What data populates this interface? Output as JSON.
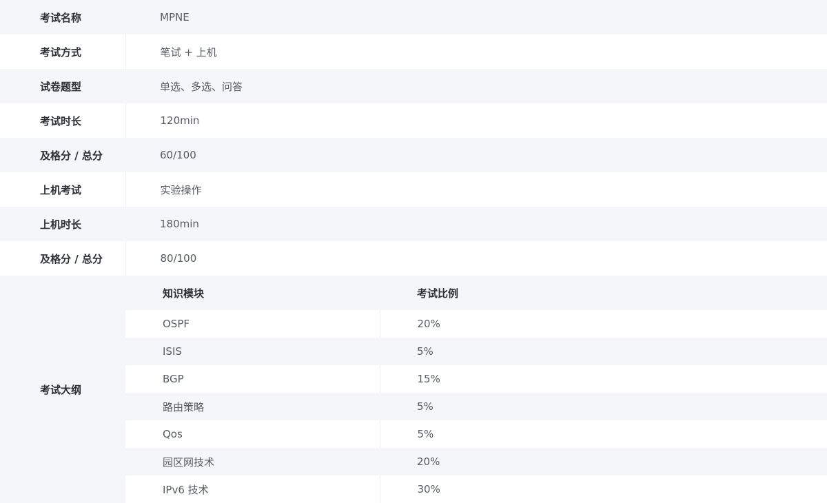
{
  "rows": [
    {
      "label": "考试名称",
      "value": "MPNE"
    },
    {
      "label": "考试方式",
      "value": "笔试 + 上机"
    },
    {
      "label": "试卷题型",
      "value": "单选、多选、问答"
    },
    {
      "label": "考试时长",
      "value": "120min"
    },
    {
      "label": "及格分 / 总分",
      "value": "60/100"
    },
    {
      "label": "上机考试",
      "value": "实验操作"
    },
    {
      "label": "上机时长",
      "value": "180min"
    },
    {
      "label": "及格分 / 总分",
      "value": "80/100"
    }
  ],
  "syllabus": {
    "label": "考试大纲",
    "headers": {
      "module": "知识模块",
      "ratio": "考试比例"
    },
    "items": [
      {
        "module": "OSPF",
        "ratio": "20%"
      },
      {
        "module": "ISIS",
        "ratio": "5%"
      },
      {
        "module": "BGP",
        "ratio": "15%"
      },
      {
        "module": "路由策略",
        "ratio": "5%"
      },
      {
        "module": "Qos",
        "ratio": "5%"
      },
      {
        "module": "园区网技术",
        "ratio": "20%"
      },
      {
        "module": "IPv6 技术",
        "ratio": "30%"
      }
    ]
  }
}
